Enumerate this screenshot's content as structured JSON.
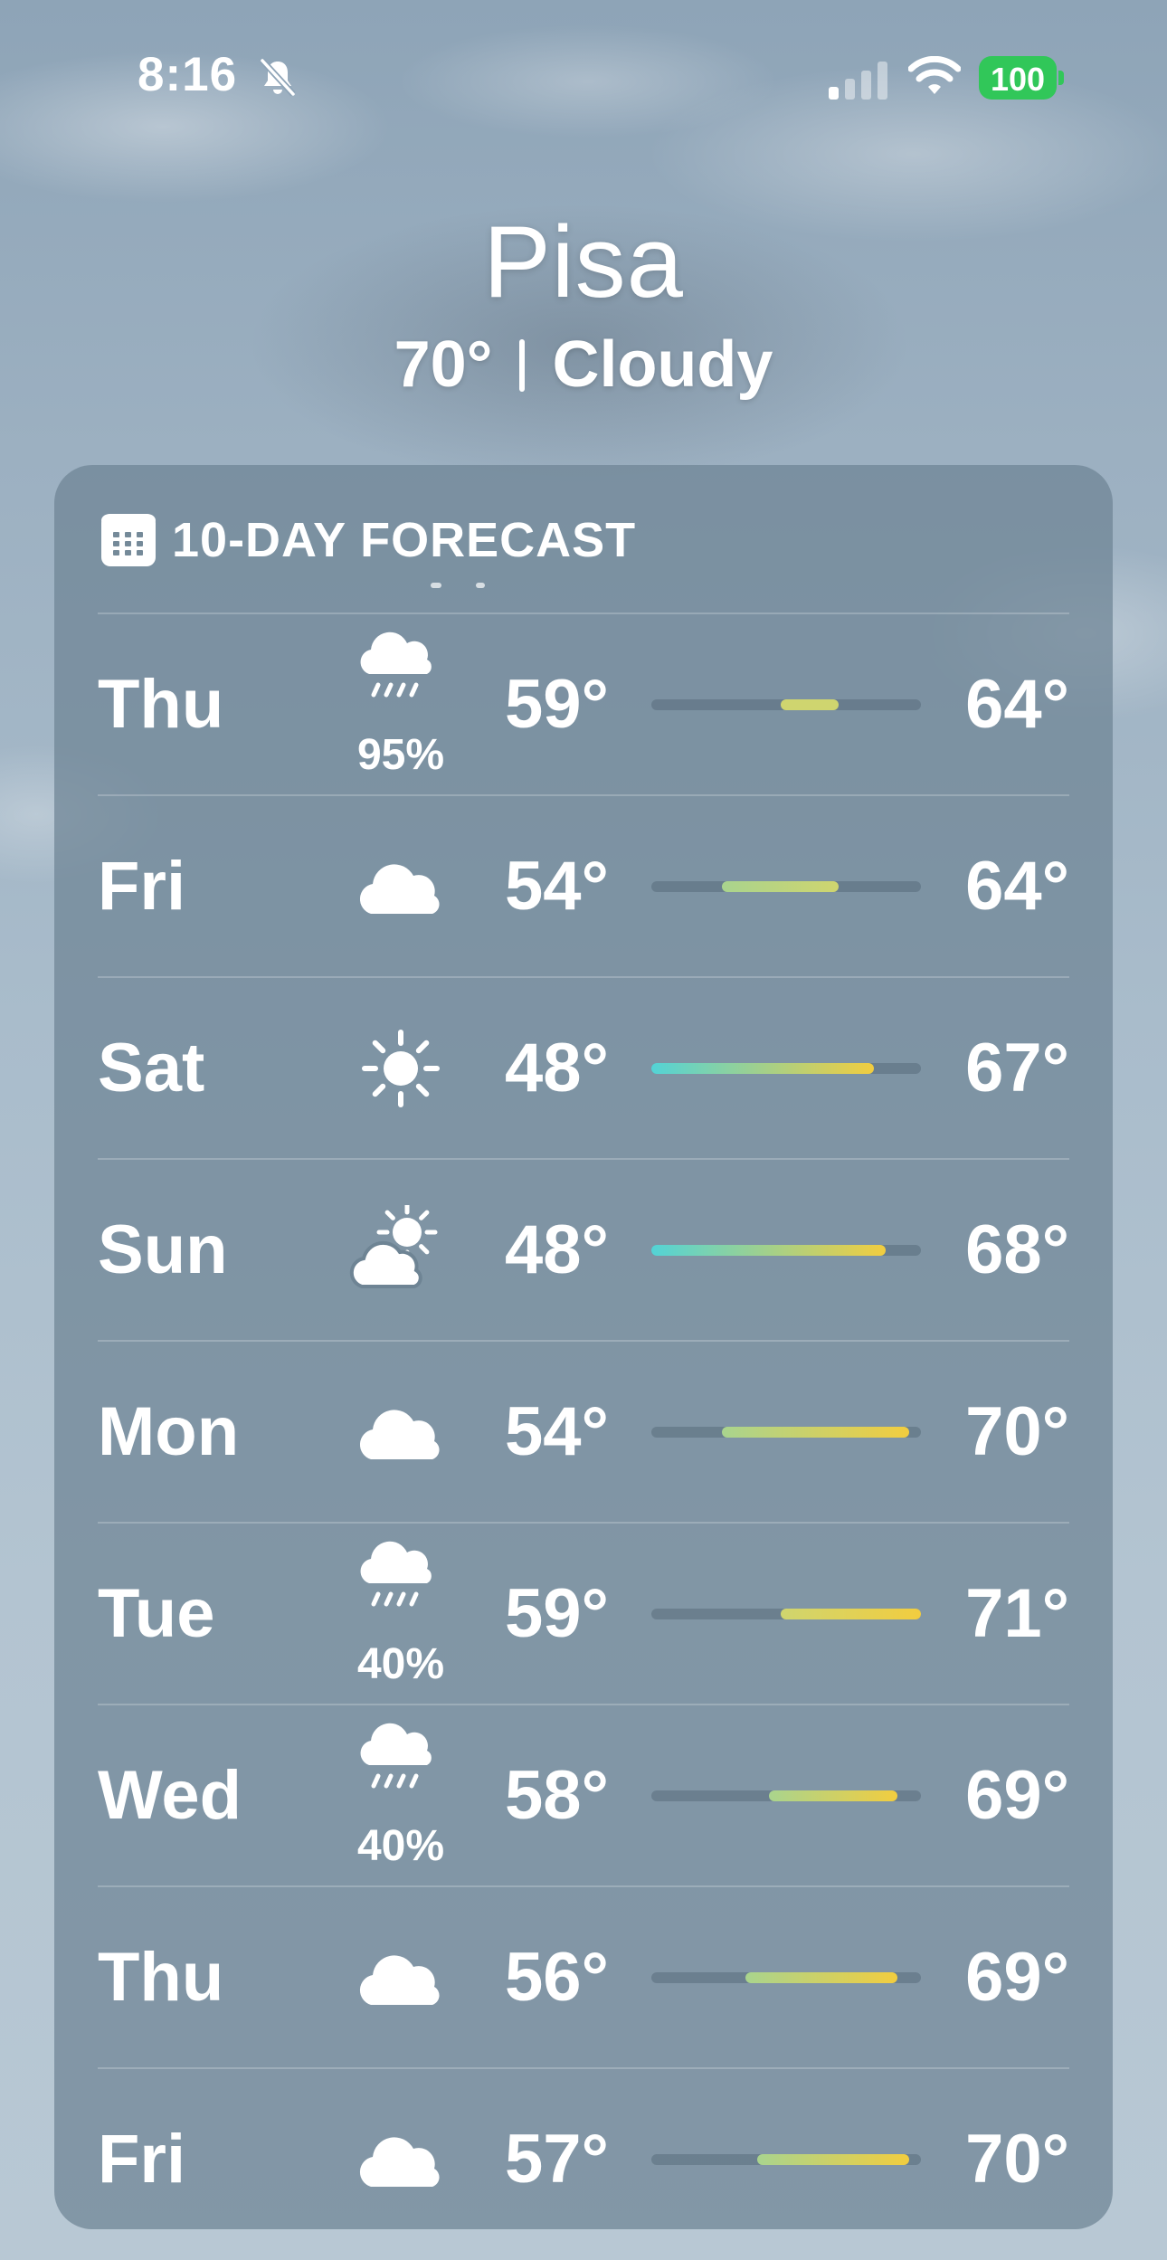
{
  "status_bar": {
    "time": "8:16",
    "battery": "100",
    "icons": [
      "bell-slash-icon",
      "cellular-signal-icon",
      "wifi-icon",
      "battery-icon"
    ]
  },
  "location": {
    "city": "Pisa",
    "temp": "70°",
    "condition": "Cloudy"
  },
  "forecast": {
    "title": "10-DAY FORECAST",
    "range_min": 48,
    "range_max": 71,
    "days": [
      {
        "day": "Thu",
        "icon": "cloud-rain-icon",
        "precip": "95%",
        "low": "59°",
        "high": "64°",
        "low_val": 59,
        "high_val": 64
      },
      {
        "day": "Fri",
        "icon": "cloud-icon",
        "precip": "",
        "low": "54°",
        "high": "64°",
        "low_val": 54,
        "high_val": 64
      },
      {
        "day": "Sat",
        "icon": "sun-icon",
        "precip": "",
        "low": "48°",
        "high": "67°",
        "low_val": 48,
        "high_val": 67
      },
      {
        "day": "Sun",
        "icon": "cloud-sun-icon",
        "precip": "",
        "low": "48°",
        "high": "68°",
        "low_val": 48,
        "high_val": 68
      },
      {
        "day": "Mon",
        "icon": "cloud-icon",
        "precip": "",
        "low": "54°",
        "high": "70°",
        "low_val": 54,
        "high_val": 70
      },
      {
        "day": "Tue",
        "icon": "cloud-rain-icon",
        "precip": "40%",
        "low": "59°",
        "high": "71°",
        "low_val": 59,
        "high_val": 71
      },
      {
        "day": "Wed",
        "icon": "cloud-rain-icon",
        "precip": "40%",
        "low": "58°",
        "high": "69°",
        "low_val": 58,
        "high_val": 69
      },
      {
        "day": "Thu",
        "icon": "cloud-icon",
        "precip": "",
        "low": "56°",
        "high": "69°",
        "low_val": 56,
        "high_val": 69
      },
      {
        "day": "Fri",
        "icon": "cloud-icon",
        "precip": "",
        "low": "57°",
        "high": "70°",
        "low_val": 57,
        "high_val": 70
      }
    ]
  },
  "colors": {
    "battery": "#31c759",
    "cold": "#53d3d6",
    "mild": "#a9d48e",
    "warm": "#cfd56f",
    "hot": "#f2cd3f"
  }
}
